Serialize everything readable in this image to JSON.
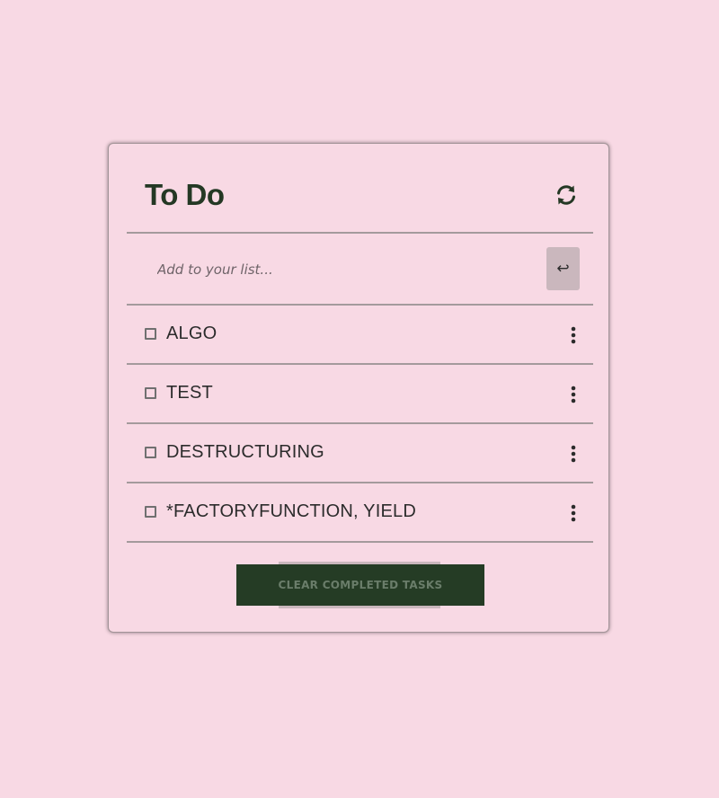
{
  "app": {
    "title": "To Do"
  },
  "input": {
    "placeholder": "Add to your list...",
    "value": "",
    "enter_icon": "↩"
  },
  "tasks": [
    {
      "label": "ALGO",
      "completed": false
    },
    {
      "label": "TEST",
      "completed": false
    },
    {
      "label": "DESTRUCTURING",
      "completed": false
    },
    {
      "label": "*FACTORYFUNCTION, YIELD",
      "completed": false
    }
  ],
  "footer": {
    "clear_label": "CLEAR COMPLETED TASKS"
  },
  "icons": {
    "refresh": "refresh-icon",
    "enter": "enter-icon",
    "more": "more-vertical-icon",
    "checkbox": "checkbox-icon"
  },
  "colors": {
    "background": "#f8d9e4",
    "title": "#243824",
    "button_dark": "#253c25",
    "button_light": "#cab7bd",
    "divider": "#a49a9c"
  }
}
